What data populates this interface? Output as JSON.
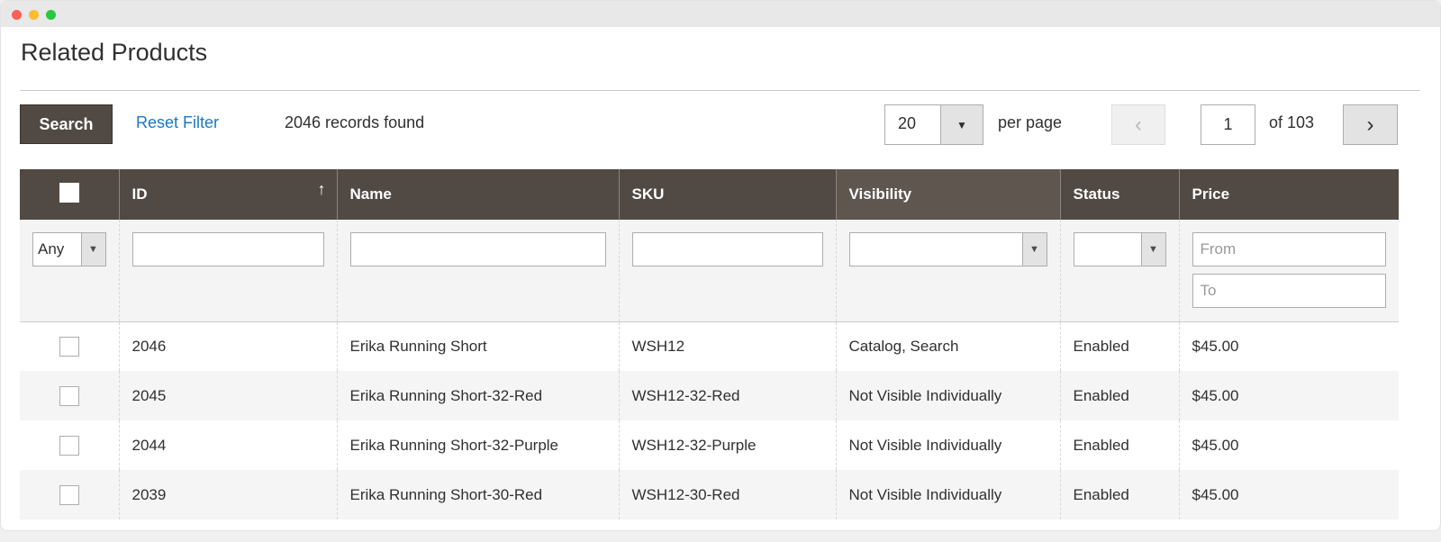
{
  "page_title": "Related Products",
  "toolbar": {
    "search_label": "Search",
    "reset_label": "Reset Filter",
    "records": "2046 records found",
    "per_page_value": "20",
    "per_page_label": "per page",
    "page_value": "1",
    "page_of": "of 103"
  },
  "columns": [
    "ID",
    "Name",
    "SKU",
    "Visibility",
    "Status",
    "Price"
  ],
  "filters": {
    "any": "Any",
    "price_from": "From",
    "price_to": "To"
  },
  "rows": [
    {
      "id": "2046",
      "name": "Erika Running Short",
      "sku": "WSH12",
      "visibility": "Catalog, Search",
      "status": "Enabled",
      "price": "$45.00"
    },
    {
      "id": "2045",
      "name": "Erika Running Short-32-Red",
      "sku": "WSH12-32-Red",
      "visibility": "Not Visible Individually",
      "status": "Enabled",
      "price": "$45.00"
    },
    {
      "id": "2044",
      "name": "Erika Running Short-32-Purple",
      "sku": "WSH12-32-Purple",
      "visibility": "Not Visible Individually",
      "status": "Enabled",
      "price": "$45.00"
    },
    {
      "id": "2039",
      "name": "Erika Running Short-30-Red",
      "sku": "WSH12-30-Red",
      "visibility": "Not Visible Individually",
      "status": "Enabled",
      "price": "$45.00"
    }
  ]
}
